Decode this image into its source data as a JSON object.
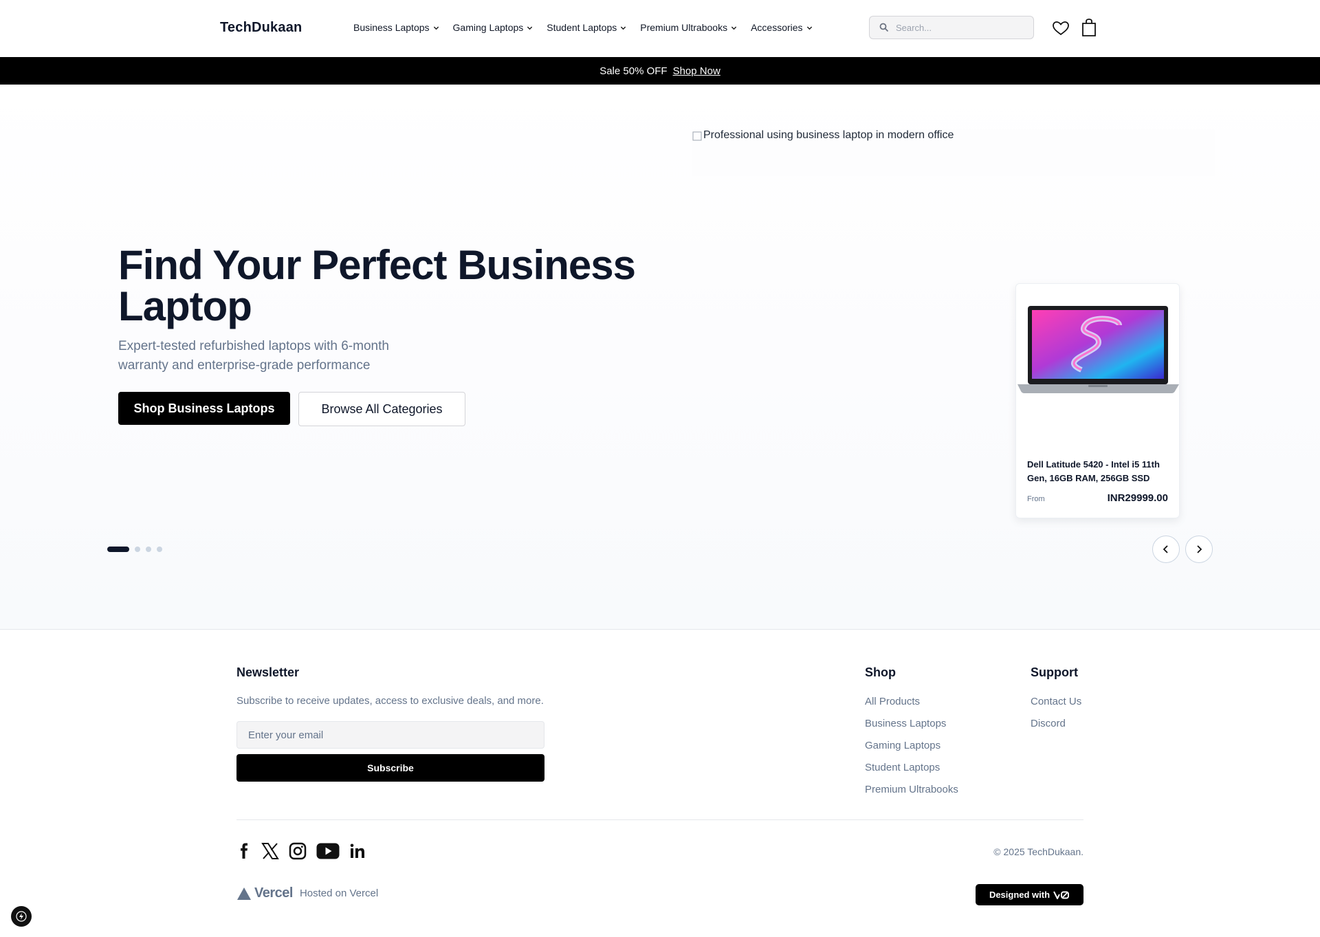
{
  "header": {
    "logo": "TechDukaan",
    "nav": [
      {
        "label": "Business Laptops"
      },
      {
        "label": "Gaming Laptops"
      },
      {
        "label": "Student Laptops"
      },
      {
        "label": "Premium Ultrabooks"
      },
      {
        "label": "Accessories"
      }
    ],
    "search_placeholder": "Search...",
    "icons": {
      "search": "search-icon",
      "wishlist": "heart-icon",
      "cart": "shopping-bag-icon"
    }
  },
  "promo": {
    "text": "Sale 50% OFF",
    "link": "Shop Now"
  },
  "hero": {
    "image_alt": "Professional using business laptop in modern office",
    "title": "Find Your Perfect Business Laptop",
    "subtitle": "Expert-tested refurbished laptops with 6-month warranty and enterprise-grade performance",
    "primary_button": "Shop Business Laptops",
    "secondary_button": "Browse All Categories",
    "slides_total": 4,
    "active_slide": 1
  },
  "product_card": {
    "name": "Dell Latitude 5420 - Intel i5 11th Gen, 16GB RAM, 256GB SSD",
    "from_label": "From",
    "price": "INR29999.00"
  },
  "footer": {
    "newsletter": {
      "title": "Newsletter",
      "text": "Subscribe to receive updates, access to exclusive deals, and more.",
      "email_placeholder": "Enter your email",
      "button": "Subscribe"
    },
    "shop": {
      "title": "Shop",
      "links": [
        "All Products",
        "Business Laptops",
        "Gaming Laptops",
        "Student Laptops",
        "Premium Ultrabooks"
      ]
    },
    "support": {
      "title": "Support",
      "links": [
        "Contact Us",
        "Discord"
      ]
    },
    "socials": [
      "facebook-icon",
      "x-icon",
      "instagram-icon",
      "youtube-icon",
      "linkedin-icon"
    ],
    "copyright": "© 2025 TechDukaan.",
    "vercel_logo_text": "Vercel",
    "hosted": "Hosted on Vercel",
    "designed_with": "Designed with"
  },
  "colors": {
    "brand_dark": "#0f172a",
    "muted": "#64748b",
    "promo_bg": "#000000"
  }
}
